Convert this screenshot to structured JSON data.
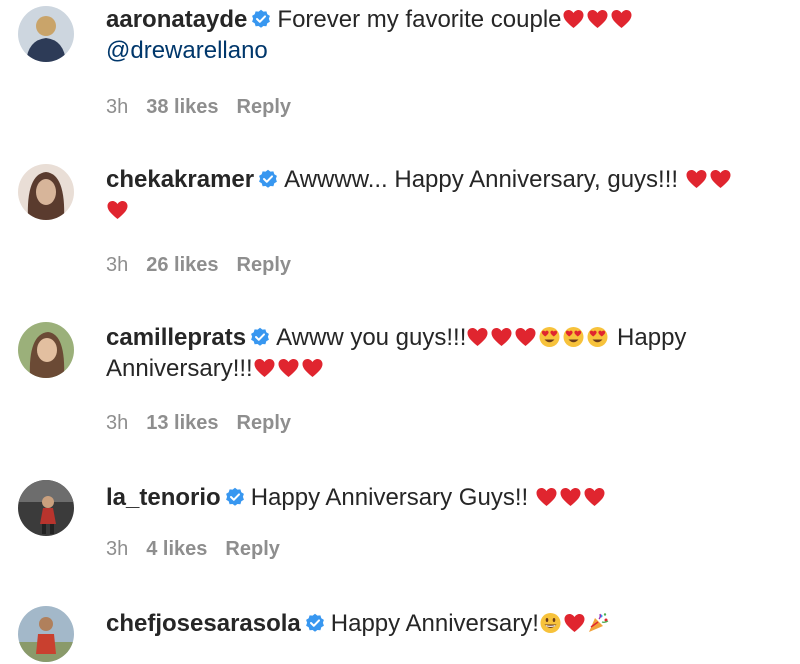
{
  "comments": [
    {
      "username": "aaronatayde",
      "text": "Forever my favorite couple",
      "emojis_after_text": [
        "heart",
        "heart",
        "heart"
      ],
      "mention": "@drewarellano",
      "time": "3h",
      "likes": "38 likes",
      "reply": "Reply",
      "avatar_colors": [
        "#c9a46a",
        "#2d3b57"
      ]
    },
    {
      "username": "chekakramer",
      "text": "Awwww... Happy Anniversary, guys!!! ",
      "emojis_after_text": [
        "heart",
        "heart",
        "heart"
      ],
      "time": "3h",
      "likes": "26 likes",
      "reply": "Reply",
      "avatar_colors": [
        "#d7b59a",
        "#5a3b2e"
      ]
    },
    {
      "username": "camilleprats",
      "text": "Awww you guys!!!",
      "emojis_after_text": [
        "heart",
        "heart",
        "heart",
        "heart-eyes",
        "heart-eyes",
        "heart-eyes"
      ],
      "text2": " Happy Anniversary!!!",
      "emojis_after_text2": [
        "heart",
        "heart",
        "heart"
      ],
      "time": "3h",
      "likes": "13 likes",
      "reply": "Reply",
      "avatar_colors": [
        "#9bb07a",
        "#6b4a35"
      ]
    },
    {
      "username": "la_tenorio",
      "text": "Happy Anniversary Guys!! ",
      "emojis_after_text": [
        "heart",
        "heart",
        "heart"
      ],
      "time": "3h",
      "likes": "4 likes",
      "reply": "Reply",
      "avatar_colors": [
        "#3b3b3b",
        "#b8342d"
      ]
    },
    {
      "username": "chefjosesarasola",
      "text": "Happy Anniversary!",
      "emojis_after_text": [
        "grin",
        "heart",
        "party-popper"
      ],
      "avatar_colors": [
        "#a3b8c9",
        "#c9402f"
      ]
    }
  ],
  "colors": {
    "verified": "#3897f0",
    "heart": "#e0252f",
    "muted": "#8e8e8e",
    "mention": "#00376b"
  }
}
